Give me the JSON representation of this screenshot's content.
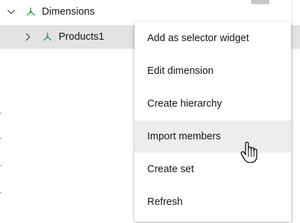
{
  "tree": {
    "items": [
      {
        "label": "Dimensions",
        "expanded": true,
        "icon": "dimension-icon"
      },
      {
        "label": "Products1",
        "expanded": false,
        "selected": true,
        "icon": "dimension-icon"
      }
    ]
  },
  "context_menu": {
    "items": [
      {
        "label": "Add as selector widget"
      },
      {
        "label": "Edit dimension"
      },
      {
        "label": "Create hierarchy"
      },
      {
        "label": "Import members",
        "hovered": true
      },
      {
        "label": "Create set"
      },
      {
        "label": "Refresh"
      }
    ]
  },
  "colors": {
    "dimension_icon": "#24a148",
    "selected_row": "#e3e3e3",
    "menu_hover": "#ededed",
    "text": "#161616"
  }
}
